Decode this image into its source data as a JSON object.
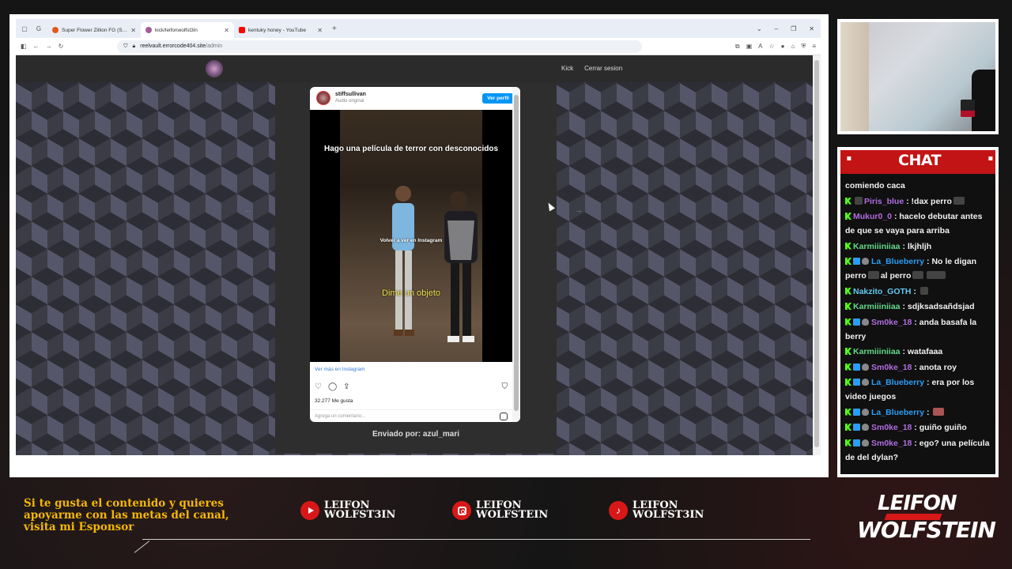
{
  "browser": {
    "tabs": [
      {
        "title": "Super Flower Zillion FG (SF-125",
        "favicon_color": "#e05a1b",
        "active": false
      },
      {
        "title": "kick/leifonwolfst3in",
        "favicon_color": "#a35c9a",
        "active": true
      },
      {
        "title": "kentuky honey - YouTube",
        "favicon_color": "#ff0000",
        "active": false
      }
    ],
    "new_tab": "+",
    "url": {
      "host": "reelvault.errorcode404.site",
      "path": "/admin"
    }
  },
  "site": {
    "nav": {
      "kick": "Kick",
      "logout": "Cerrar sesion"
    },
    "prev_arrow": "←",
    "next_arrow": "→",
    "sent_by": "Enviado por: azul_mari"
  },
  "instagram": {
    "username": "stiffsullivan",
    "audio": "Audio original",
    "view_profile": "Ver perfil",
    "caption": "Hago una película de terror con desconocidos",
    "watch_overlay": "Volver a ver en Instagram",
    "subtitle": "Dime un objeto",
    "see_more": "Ver más en Instagram",
    "likes": "32.277 Me gusta",
    "comment_placeholder": "Agrega un comentario..."
  },
  "chat": {
    "title": "CHAT",
    "messages": [
      {
        "user": "",
        "text": "comiendo caca",
        "color": "#ffffff",
        "badges": []
      },
      {
        "user": "Piris_blue",
        "text": "!dax perro",
        "color": "#b06de0",
        "badges": [
          "kick",
          "emote"
        ]
      },
      {
        "user": "Mukur0_0",
        "text": "hacelo debutar antes de que se vaya para arriba",
        "color": "#b06de0",
        "badges": [
          "kick"
        ]
      },
      {
        "user": "Karmiiiniiaa",
        "text": "lkjhljh",
        "color": "#62d98a",
        "badges": [
          "kick"
        ]
      },
      {
        "user": "La_Blueberry",
        "text": "No le digan perro",
        "text2": "al perro",
        "color": "#2a9df4",
        "badges": [
          "kick",
          "blue",
          "sub"
        ]
      },
      {
        "user": "Nakzito_GOTH",
        "text": "",
        "color": "#62c8ef",
        "badges": [
          "kick"
        ]
      },
      {
        "user": "Karmiiiniiaa",
        "text": "sdjksadsañdsjad",
        "color": "#62d98a",
        "badges": [
          "kick"
        ]
      },
      {
        "user": "Sm0ke_18",
        "text": "anda basafa la berry",
        "color": "#b06de0",
        "badges": [
          "kick",
          "blue",
          "sub"
        ]
      },
      {
        "user": "Karmiiiniiaa",
        "text": "watafaaa",
        "color": "#62d98a",
        "badges": [
          "kick"
        ]
      },
      {
        "user": "Sm0ke_18",
        "text": "anota roy",
        "color": "#b06de0",
        "badges": [
          "kick",
          "blue",
          "sub"
        ]
      },
      {
        "user": "La_Blueberry",
        "text": "era por los video juegos",
        "color": "#2a9df4",
        "badges": [
          "kick",
          "blue",
          "sub"
        ]
      },
      {
        "user": "La_Blueberry",
        "text": "",
        "color": "#2a9df4",
        "badges": [
          "kick",
          "blue",
          "sub"
        ]
      },
      {
        "user": "Sm0ke_18",
        "text": "guiño guiño",
        "color": "#b06de0",
        "badges": [
          "kick",
          "blue",
          "sub"
        ]
      },
      {
        "user": "Sm0ke_18",
        "text": "ego? una película de del dylan?",
        "color": "#b06de0",
        "badges": [
          "kick",
          "blue",
          "sub"
        ]
      }
    ]
  },
  "bottom": {
    "sponsor_text": "Si te gusta el contenido y quieres apoyarme con las metas del canal, visita mi Esponsor",
    "socials": [
      {
        "icon": "youtube-icon",
        "line1": "LEIFON",
        "line2": "WOLFST3IN"
      },
      {
        "icon": "instagram-icon",
        "line1": "LEIFON",
        "line2": "WOLFSTEIN"
      },
      {
        "icon": "tiktok-icon",
        "line1": "LEIFON",
        "line2": "WOLFST3IN"
      }
    ],
    "logo_line1": "LEIFON",
    "logo_line2": "WOLFSTEIN"
  }
}
